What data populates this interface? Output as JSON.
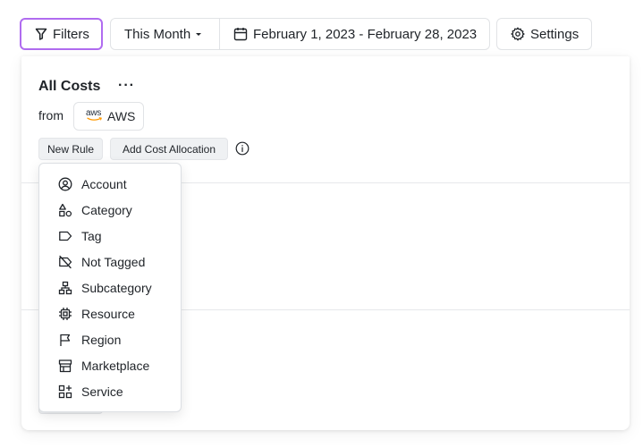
{
  "toolbar": {
    "filters_label": "Filters",
    "month_label": "This Month",
    "date_range_label": "February 1, 2023 - February 28, 2023",
    "settings_label": "Settings"
  },
  "cost_card": {
    "title": "All Costs",
    "more_label": "···",
    "from_label": "from",
    "provider_label": "AWS",
    "provider_logo_text": "aws",
    "new_rule_label": "New Rule",
    "add_cost_allocation_label": "Add Cost Allocation"
  },
  "filter_menu": {
    "items": [
      {
        "label": "Account",
        "icon": "user-circle-icon"
      },
      {
        "label": "Category",
        "icon": "shapes-icon"
      },
      {
        "label": "Tag",
        "icon": "tag-icon"
      },
      {
        "label": "Not Tagged",
        "icon": "tag-off-icon"
      },
      {
        "label": "Subcategory",
        "icon": "hierarchy-icon"
      },
      {
        "label": "Resource",
        "icon": "cpu-chip-icon"
      },
      {
        "label": "Region",
        "icon": "flag-icon"
      },
      {
        "label": "Marketplace",
        "icon": "storefront-icon"
      },
      {
        "label": "Service",
        "icon": "apps-plus-icon"
      }
    ]
  },
  "colors": {
    "accent_border": "#b06cf0",
    "divider": "#e6e8eb",
    "chip_background": "#eff1f3"
  }
}
